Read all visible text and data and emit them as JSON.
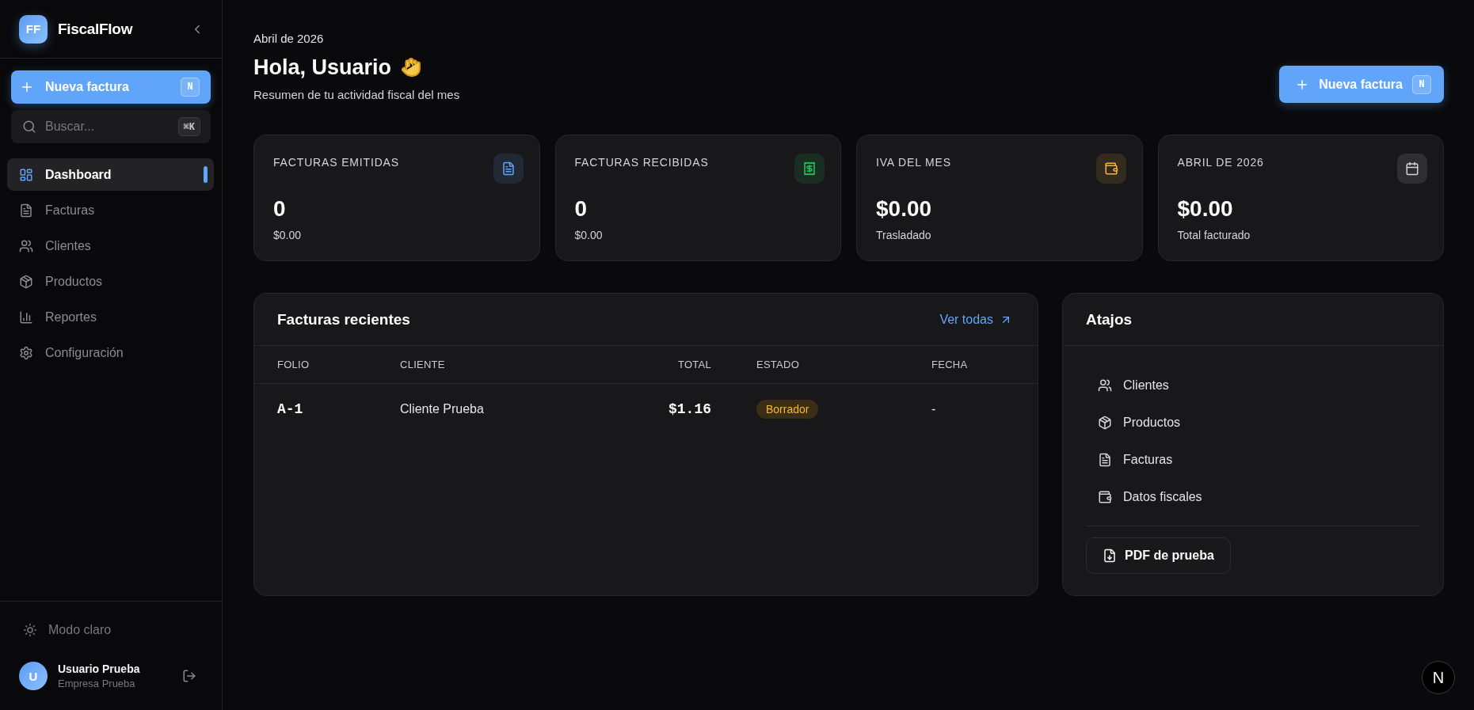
{
  "sidebar": {
    "logo": "FF",
    "brand": "FiscalFlow",
    "new_invoice_button": {
      "label": "Nueva factura",
      "shortcut": "N"
    },
    "search": {
      "placeholder": "Buscar...",
      "shortcut": "⌘K"
    },
    "nav_items": [
      {
        "label": "Dashboard",
        "selected": true
      },
      {
        "label": "Facturas",
        "selected": false
      },
      {
        "label": "Clientes",
        "selected": false
      },
      {
        "label": "Productos",
        "selected": false
      },
      {
        "label": "Reportes",
        "selected": false
      },
      {
        "label": "Configuración",
        "selected": false
      }
    ],
    "theme_toggle": "Modo claro",
    "user": {
      "initial": "U",
      "name": "Usuario Prueba",
      "company": "Empresa Prueba"
    }
  },
  "header": {
    "date": "Abril de 2026",
    "greeting": "Hola, Usuario",
    "subtitle": "Resumen de tu actividad fiscal del mes",
    "new_invoice_button": {
      "label": "Nueva factura",
      "shortcut": "N"
    }
  },
  "stats": [
    {
      "label": "FACTURAS EMITIDAS",
      "color": "#60a5fa",
      "value": "0",
      "caption": "$0.00"
    },
    {
      "label": "FACTURAS RECIBIDAS",
      "color": "#22c55e",
      "value": "0",
      "caption": "$0.00"
    },
    {
      "label": "IVA DEL MES",
      "color": "#f5b731",
      "value": "$0.00",
      "caption": "Trasladado"
    },
    {
      "label": "ABRIL DE 2026",
      "color": "#d4d4d8",
      "value": "$0.00",
      "caption": "Total facturado"
    }
  ],
  "recent_invoices": {
    "title": "Facturas recientes",
    "link": "Ver todas",
    "columns": [
      "FOLIO",
      "CLIENTE",
      "TOTAL",
      "ESTADO",
      "FECHA"
    ],
    "rows": [
      {
        "folio": "A-1",
        "client": "Cliente Prueba",
        "total": "$1.16",
        "status": "Borrador",
        "date": "-"
      }
    ]
  },
  "shortcuts": {
    "title": "Atajos",
    "items": [
      "Clientes",
      "Productos",
      "Facturas",
      "Datos fiscales"
    ],
    "pdf_button": "PDF de prueba"
  },
  "dev_indicator": "N"
}
